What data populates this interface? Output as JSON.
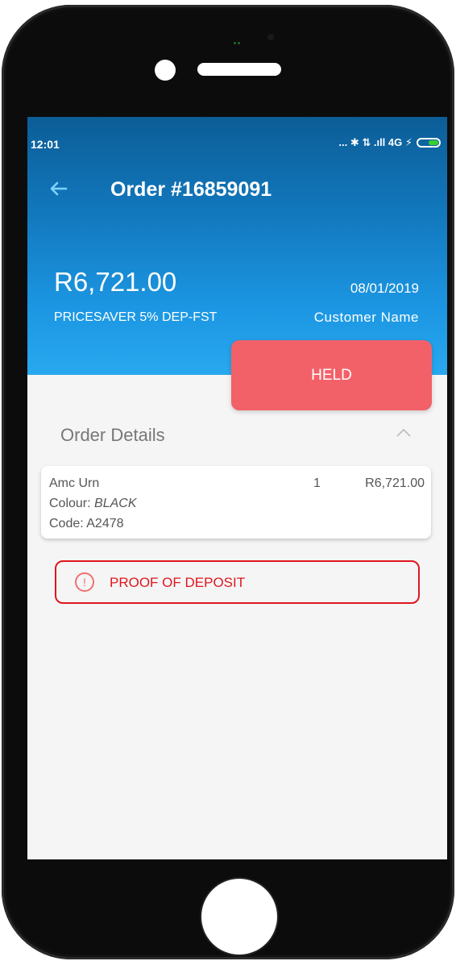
{
  "status_bar": {
    "time": "12:01",
    "icons_text": "... ✱ ⇅ .ıll 4G ⚡",
    "battery_color": "#36d130"
  },
  "header": {
    "title": "Order #16859091",
    "back_icon": "arrow-left-icon",
    "amount": "R6,721.00",
    "plan": "PRICESAVER 5% DEP-FST",
    "date": "08/01/2019",
    "customer": "Customer Name"
  },
  "status_button": {
    "label": "HELD",
    "color": "#f36168"
  },
  "order_details": {
    "title": "Order Details",
    "toggle_icon": "chevron-up-icon",
    "items": [
      {
        "name": "Amc Urn",
        "qty": "1",
        "price": "R6,721.00",
        "colour_label": "Colour: ",
        "colour_value": "BLACK",
        "code": "Code: A2478"
      }
    ]
  },
  "alert_button": {
    "label": "PROOF OF DEPOSIT",
    "icon": "alert-circle-icon",
    "color": "#e0161e"
  },
  "colors": {
    "header_top": "#0b5d96",
    "header_bottom": "#29a8ef",
    "background": "#f5f5f5"
  }
}
